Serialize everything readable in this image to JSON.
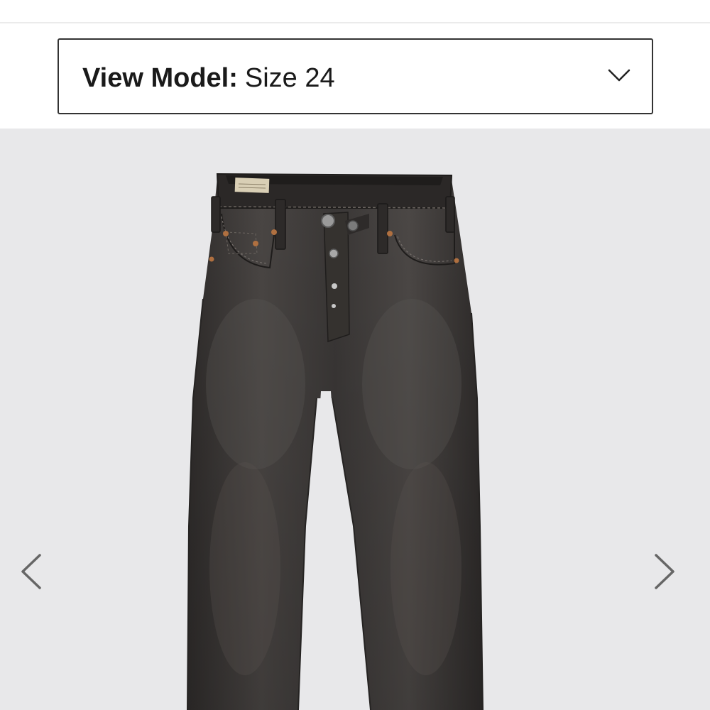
{
  "model_selector": {
    "label": "View Model:",
    "value": "Size 24",
    "icon": "chevron-down-icon"
  },
  "gallery": {
    "image": "black-denim-jeans-product-photo",
    "prev_icon": "chevron-left-icon",
    "next_icon": "chevron-right-icon"
  },
  "colors": {
    "border": "#333333",
    "gallery_background": "#e8e8ea",
    "denim": "#3b3837",
    "arrow": "#666666"
  }
}
